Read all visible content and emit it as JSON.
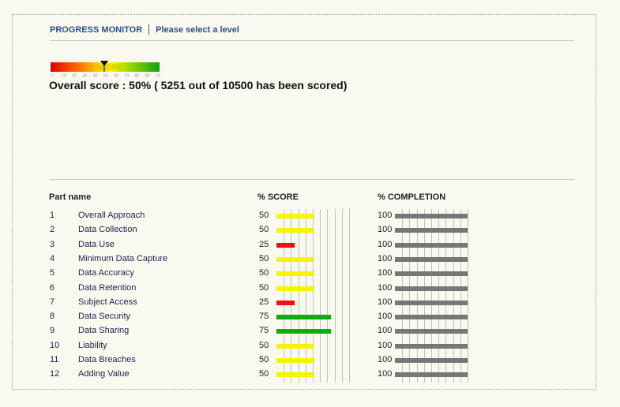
{
  "nav": {
    "title": "PROGRESS MONITOR",
    "link": "Please select a level"
  },
  "gauge": {
    "label": "% SCORE",
    "ticks": [
      "0",
      "10",
      "20",
      "30",
      "40",
      "50",
      "60",
      "70",
      "80",
      "90",
      "100"
    ],
    "pointer_value": 50
  },
  "overall_text": "Overall score : 50% ( 5251 out of 10500 has been scored)",
  "headers": {
    "name": "Part name",
    "score": "% SCORE",
    "completion": "% COMPLETION"
  },
  "colors": {
    "low": "#ee1111",
    "mid": "#f5f500",
    "high": "#11aa11",
    "completion": "#777777"
  },
  "rows": [
    {
      "num": "1",
      "name": "Overall Approach",
      "score": 50,
      "completion": 100
    },
    {
      "num": "2",
      "name": "Data Collection",
      "score": 50,
      "completion": 100
    },
    {
      "num": "3",
      "name": "Data Use",
      "score": 25,
      "completion": 100
    },
    {
      "num": "4",
      "name": "Minimum Data Capture",
      "score": 50,
      "completion": 100
    },
    {
      "num": "5",
      "name": "Data Accuracy",
      "score": 50,
      "completion": 100
    },
    {
      "num": "6",
      "name": "Data Retention",
      "score": 50,
      "completion": 100
    },
    {
      "num": "7",
      "name": "Subject Access",
      "score": 25,
      "completion": 100
    },
    {
      "num": "8",
      "name": "Data Security",
      "score": 75,
      "completion": 100
    },
    {
      "num": "9",
      "name": "Data Sharing",
      "score": 75,
      "completion": 100
    },
    {
      "num": "10",
      "name": "Liability",
      "score": 50,
      "completion": 100
    },
    {
      "num": "11",
      "name": "Data Breaches",
      "score": 50,
      "completion": 100
    },
    {
      "num": "12",
      "name": "Adding Value",
      "score": 50,
      "completion": 100
    }
  ]
}
